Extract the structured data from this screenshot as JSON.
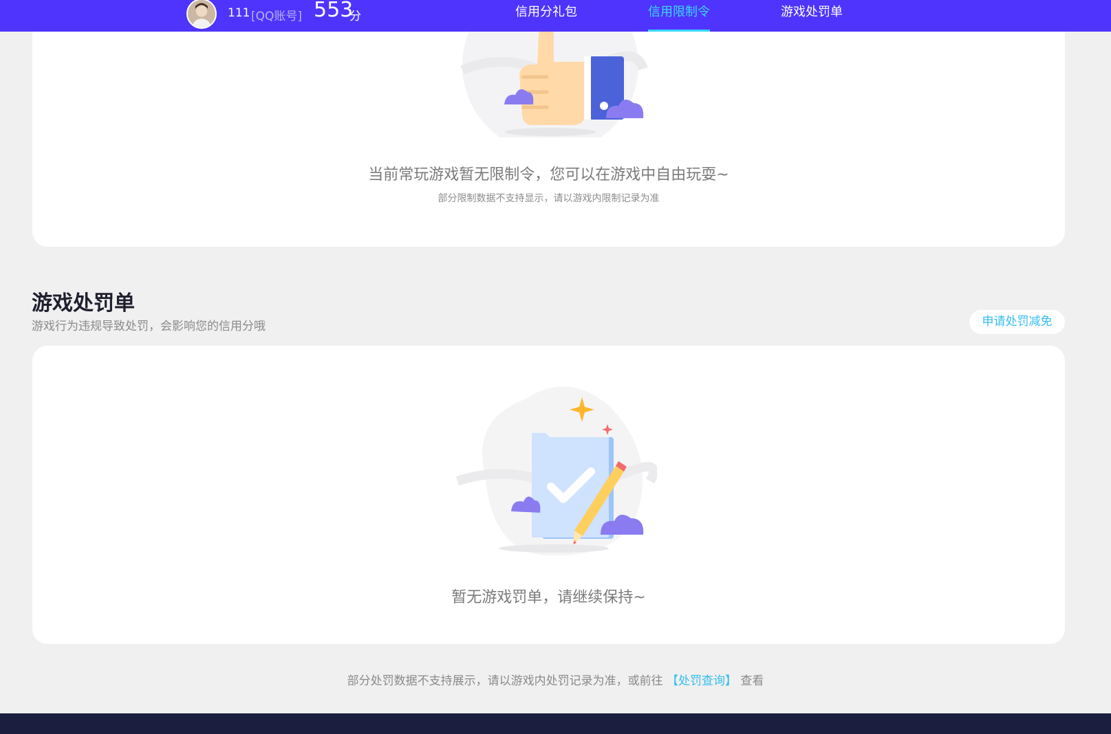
{
  "header": {
    "account_id": "111",
    "account_type": "[QQ账号]",
    "score": "553",
    "score_unit": "分",
    "tabs": [
      {
        "label": "信用分礼包",
        "active": false
      },
      {
        "label": "信用限制令",
        "active": true
      },
      {
        "label": "游戏处罚单",
        "active": false
      }
    ]
  },
  "limit_card": {
    "empty_title": "当前常玩游戏暂无限制令，您可以在游戏中自由玩耍~",
    "empty_note": "部分限制数据不支持显示，请以游戏内限制记录为准"
  },
  "penalty_section": {
    "title": "游戏处罚单",
    "description": "游戏行为违规导致处罚，会影响您的信用分哦",
    "appeal_button": "申请处罚减免",
    "empty_title": "暂无游戏罚单，请继续保持~"
  },
  "footer": {
    "note_prefix": "部分处罚数据不支持展示，请以游戏内处罚记录为准，或前往",
    "note_link": "【处罚查询】",
    "note_suffix": "查看"
  },
  "colors": {
    "header_bg": "#4f34fe",
    "accent": "#3ad8ff",
    "link": "#36bdf0",
    "page_bg": "#f0f0f0",
    "bottom_bar": "#1c1e3f"
  }
}
